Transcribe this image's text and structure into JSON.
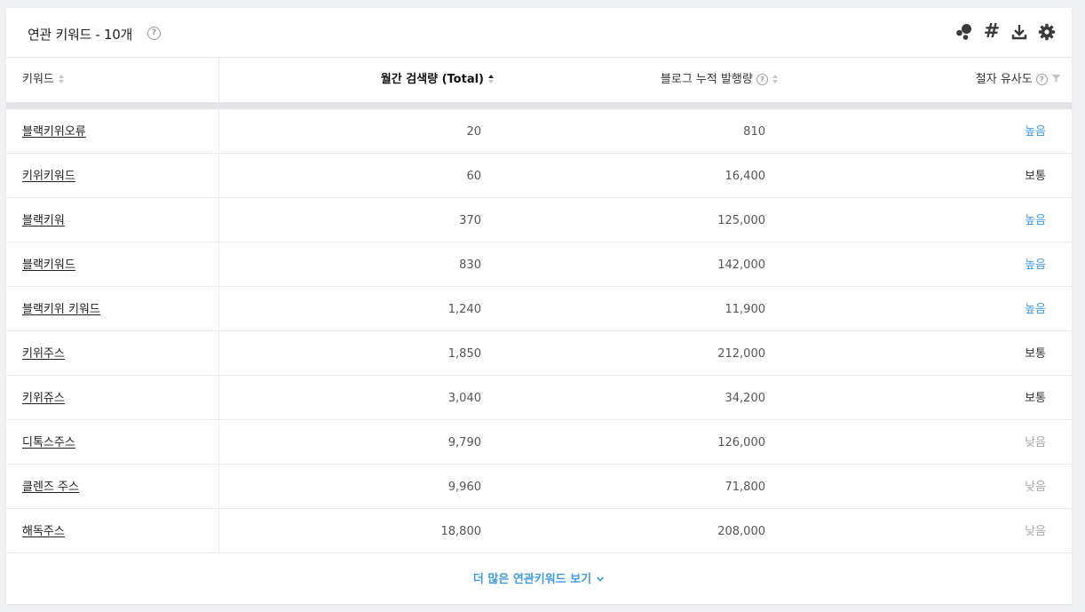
{
  "header": {
    "title": "연관 키워드 - 10개",
    "help": "?"
  },
  "toolbar": {
    "icons": [
      "bubble-chart-icon",
      "hashtag-icon",
      "download-icon",
      "settings-gear-icon"
    ],
    "hash_glyph": "#"
  },
  "table": {
    "columns": {
      "keyword": "키워드",
      "monthly_volume": "월간 검색량 (Total)",
      "blog_posts": "블로그 누적 발행량",
      "similarity": "철자 유사도"
    },
    "rows": [
      {
        "keyword": "블랙키위오류",
        "volume": "20",
        "blog": "810",
        "similarity": "높음"
      },
      {
        "keyword": "키위키워드",
        "volume": "60",
        "blog": "16,400",
        "similarity": "보통"
      },
      {
        "keyword": "블랙키워",
        "volume": "370",
        "blog": "125,000",
        "similarity": "높음"
      },
      {
        "keyword": "블랙키워드",
        "volume": "830",
        "blog": "142,000",
        "similarity": "높음"
      },
      {
        "keyword": "블랙키위 키워드",
        "volume": "1,240",
        "blog": "11,900",
        "similarity": "높음"
      },
      {
        "keyword": "키위주스",
        "volume": "1,850",
        "blog": "212,000",
        "similarity": "보통"
      },
      {
        "keyword": "키위쥬스",
        "volume": "3,040",
        "blog": "34,200",
        "similarity": "보통"
      },
      {
        "keyword": "디톡스주스",
        "volume": "9,790",
        "blog": "126,000",
        "similarity": "낮음"
      },
      {
        "keyword": "클렌즈 주스",
        "volume": "9,960",
        "blog": "71,800",
        "similarity": "낮음"
      },
      {
        "keyword": "해독주스",
        "volume": "18,800",
        "blog": "208,000",
        "similarity": "낮음"
      }
    ]
  },
  "footer": {
    "more_label": "더 많은 연관키워드 보기"
  },
  "colors": {
    "high": "#3d9be9",
    "medium": "#333333",
    "low": "#a8a8a8",
    "accent": "#3d9be9"
  }
}
